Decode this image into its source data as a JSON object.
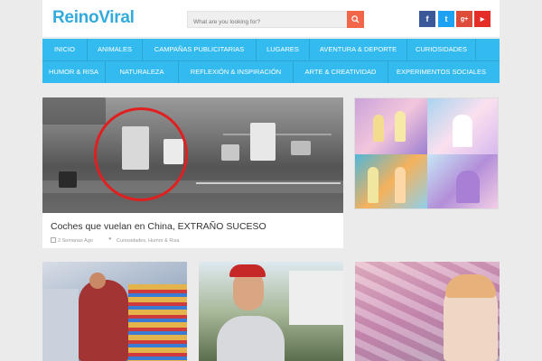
{
  "site": {
    "name": "ReinoViral"
  },
  "search": {
    "placeholder": "What are you looking for?"
  },
  "social": [
    {
      "icon": "facebook-icon",
      "glyph": "f",
      "color": "#3b5998"
    },
    {
      "icon": "twitter-icon",
      "glyph": "t",
      "color": "#1da1f2"
    },
    {
      "icon": "google-plus-icon",
      "glyph": "g+",
      "color": "#dd4b39"
    },
    {
      "icon": "youtube-icon",
      "glyph": "▶",
      "color": "#e52d27"
    }
  ],
  "nav": {
    "row1": [
      "INICIO",
      "ANIMALES",
      "CAMPAÑAS PUBLICITARIAS",
      "LUGARES",
      "AVENTURA & DEPORTE",
      "CURIOSIDADES"
    ],
    "row2": [
      "HUMOR & RISA",
      "NATURALEZA",
      "REFLEXIÓN & INSPIRACIÓN",
      "ARTE & CREATIVIDAD",
      "EXPERIMENTOS SOCIALES"
    ]
  },
  "featured": {
    "title": "Coches que vuelan en China, EXTRAÑO SUCESO",
    "date": "2 Semanas Ago",
    "categories": "Curiosidades, Humor & Risa"
  },
  "colors": {
    "brand": "#33aadd",
    "nav": "#33bbef",
    "search_button": "#f2664a"
  }
}
